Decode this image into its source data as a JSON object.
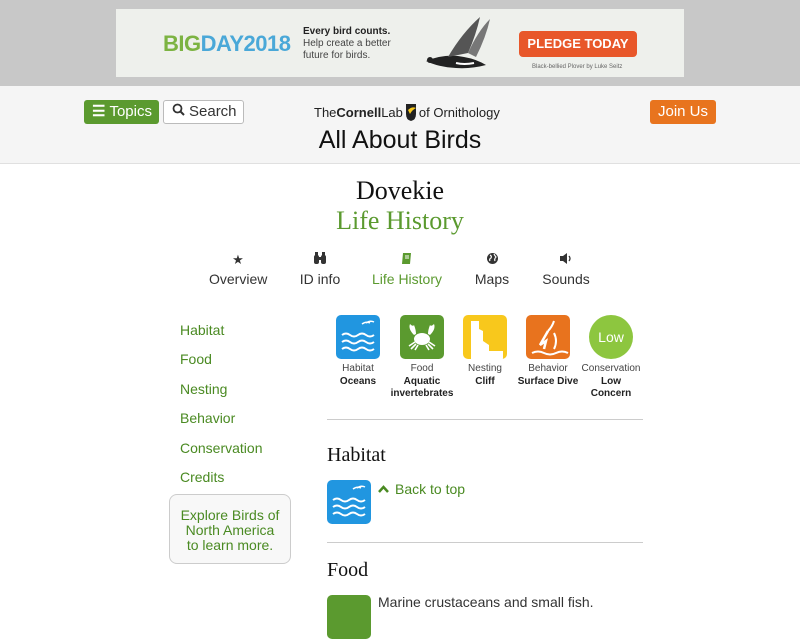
{
  "banner": {
    "logo_big": "BIG",
    "logo_day": "DAY2018",
    "tagline_line1": "Every bird counts.",
    "tagline_line2": "Help create a better",
    "tagline_line3": "future for birds.",
    "pledge_label": "PLEDGE TODAY",
    "photo_credit": "Black-bellied Plover by Luke Seitz"
  },
  "header": {
    "topics_label": "Topics",
    "search_label": "Search",
    "logo_the": "The",
    "logo_cornell": "Cornell",
    "logo_lab": "Lab",
    "logo_of": "of Ornithology",
    "site_title": "All About Birds",
    "join_label": "Join Us"
  },
  "species": {
    "name": "Dovekie",
    "page": "Life History"
  },
  "tabs": [
    {
      "label": "Overview",
      "icon": "star-icon",
      "active": false
    },
    {
      "label": "ID info",
      "icon": "binoculars-icon",
      "active": false
    },
    {
      "label": "Life History",
      "icon": "book-icon",
      "active": true
    },
    {
      "label": "Maps",
      "icon": "globe-icon",
      "active": false
    },
    {
      "label": "Sounds",
      "icon": "speaker-icon",
      "active": false
    }
  ],
  "sidebar": {
    "items": [
      "Habitat",
      "Food",
      "Nesting",
      "Behavior",
      "Conservation",
      "Credits"
    ],
    "explore_line1": "Explore Birds of",
    "explore_line2": "North America",
    "explore_line3": "to learn more."
  },
  "categories": [
    {
      "label": "Habitat",
      "value_line1": "Oceans",
      "value_line2": "",
      "color": "#2196e0",
      "icon": "ocean-icon"
    },
    {
      "label": "Food",
      "value_line1": "Aquatic",
      "value_line2": "invertebrates",
      "color": "#5b9a2f",
      "icon": "crab-icon"
    },
    {
      "label": "Nesting",
      "value_line1": "Cliff",
      "value_line2": "",
      "color": "#f8c81c",
      "icon": "cliff-icon"
    },
    {
      "label": "Behavior",
      "value_line1": "Surface Dive",
      "value_line2": "",
      "color": "#e8731e",
      "icon": "dive-icon"
    },
    {
      "label": "Conservation",
      "value_line1": "Low",
      "value_line2": "Concern",
      "color": "#8dc63f",
      "icon": "low-badge",
      "badge": "Low"
    }
  ],
  "sections": {
    "habitat_title": "Habitat",
    "back_to_top": "Back to top",
    "food_title": "Food",
    "food_text": "Marine crustaceans and small fish."
  }
}
